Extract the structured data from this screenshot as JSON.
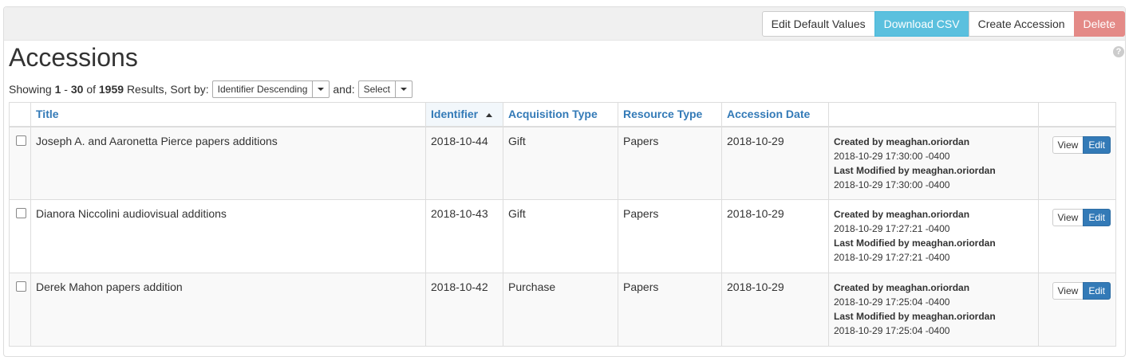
{
  "toolbar": {
    "edit_defaults_label": "Edit Default Values",
    "download_csv_label": "Download CSV",
    "create_accession_label": "Create Accession",
    "delete_label": "Delete"
  },
  "page": {
    "title": "Accessions",
    "help": "?"
  },
  "results": {
    "showing_prefix": "Showing",
    "start": "1",
    "dash": "-",
    "end": "30",
    "of": "of",
    "total": "1959",
    "results_suffix": "Results, Sort by:",
    "sort_value": "Identifier Descending",
    "and_label": "and:",
    "secondary_sort_value": "Select"
  },
  "columns": {
    "title": "Title",
    "identifier": "Identifier",
    "acquisition_type": "Acquisition Type",
    "resource_type": "Resource Type",
    "accession_date": "Accession Date"
  },
  "rows": [
    {
      "title": "Joseph A. and Aaronetta Pierce papers additions",
      "identifier": "2018-10-44",
      "acquisition_type": "Gift",
      "resource_type": "Papers",
      "accession_date": "2018-10-29",
      "created_label": "Created by meaghan.oriordan",
      "created_time": "2018-10-29 17:30:00 -0400",
      "modified_label": "Last Modified by meaghan.oriordan",
      "modified_time": "2018-10-29 17:30:00 -0400",
      "view_label": "View",
      "edit_label": "Edit"
    },
    {
      "title": "Dianora Niccolini audiovisual additions",
      "identifier": "2018-10-43",
      "acquisition_type": "Gift",
      "resource_type": "Papers",
      "accession_date": "2018-10-29",
      "created_label": "Created by meaghan.oriordan",
      "created_time": "2018-10-29 17:27:21 -0400",
      "modified_label": "Last Modified by meaghan.oriordan",
      "modified_time": "2018-10-29 17:27:21 -0400",
      "view_label": "View",
      "edit_label": "Edit"
    },
    {
      "title": "Derek Mahon papers addition",
      "identifier": "2018-10-42",
      "acquisition_type": "Purchase",
      "resource_type": "Papers",
      "accession_date": "2018-10-29",
      "created_label": "Created by meaghan.oriordan",
      "created_time": "2018-10-29 17:25:04 -0400",
      "modified_label": "Last Modified by meaghan.oriordan",
      "modified_time": "2018-10-29 17:25:04 -0400",
      "view_label": "View",
      "edit_label": "Edit"
    }
  ]
}
